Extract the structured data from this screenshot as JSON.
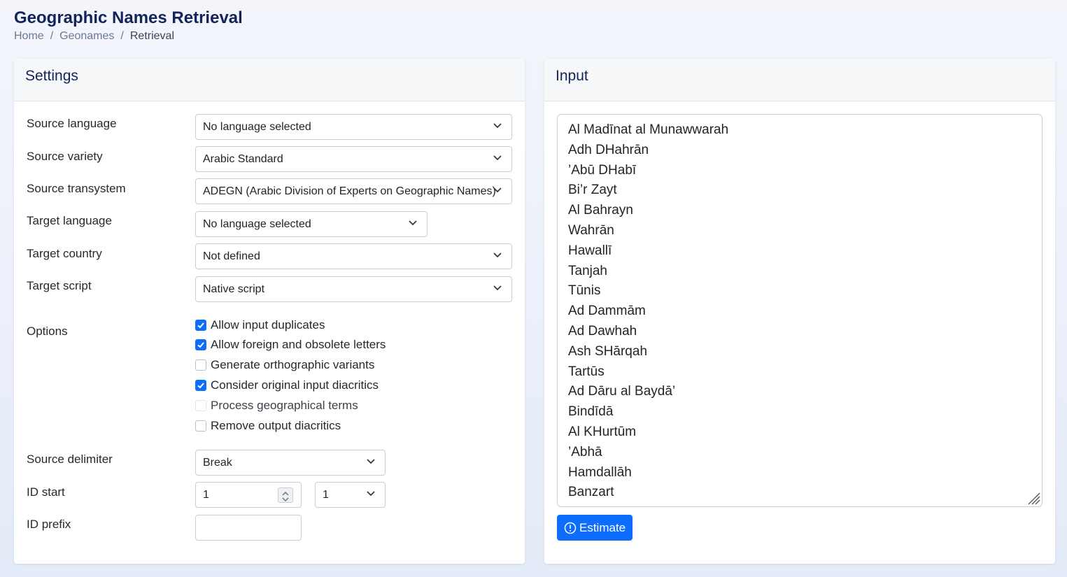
{
  "header": {
    "title": "Geographic Names Retrieval",
    "breadcrumb": [
      "Home",
      "Geonames",
      "Retrieval"
    ]
  },
  "settings": {
    "title": "Settings",
    "source_language": {
      "label": "Source language",
      "value": "No language selected"
    },
    "source_variety": {
      "label": "Source variety",
      "value": "Arabic Standard"
    },
    "source_transystem": {
      "label": "Source transystem",
      "value": "ADEGN (Arabic Division of Experts on Geographic Names)"
    },
    "target_language": {
      "label": "Target language",
      "value": "No language selected"
    },
    "target_country": {
      "label": "Target country",
      "value": "Not defined"
    },
    "target_script": {
      "label": "Target script",
      "value": "Native script"
    },
    "options": {
      "label": "Options",
      "items": [
        {
          "label": "Allow input duplicates",
          "checked": true,
          "disabled": false
        },
        {
          "label": "Allow foreign and obsolete letters",
          "checked": true,
          "disabled": false
        },
        {
          "label": "Generate orthographic variants",
          "checked": false,
          "disabled": false
        },
        {
          "label": "Consider original input diacritics",
          "checked": true,
          "disabled": false
        },
        {
          "label": "Process geographical terms",
          "checked": false,
          "disabled": true
        },
        {
          "label": "Remove output diacritics",
          "checked": false,
          "disabled": false
        }
      ]
    },
    "source_delimiter": {
      "label": "Source delimiter",
      "value": "Break"
    },
    "id_start": {
      "label": "ID start",
      "value": "1",
      "step_value": "1"
    },
    "id_prefix": {
      "label": "ID prefix",
      "value": ""
    }
  },
  "input": {
    "title": "Input",
    "lines": [
      "Al Madīnat al Munawwarah",
      "Adh DHahrān",
      "’Abū DHabī",
      "Bi’r Zayt",
      "Al Bahrayn",
      "Wahrān",
      "Hawallī",
      "Tanjah",
      "Tūnis",
      "Ad Dammām",
      "Ad Dawhah",
      "Ash SHārqah",
      "Tartūs",
      "Ad Dāru al Baydā’",
      "Bindīdā",
      "Al KHurtūm",
      "’Abhā",
      "Hamdallāh",
      "Banzart"
    ],
    "estimate_label": "Estimate"
  },
  "colors": {
    "title": "#14245a",
    "accent": "#0d6efd"
  }
}
